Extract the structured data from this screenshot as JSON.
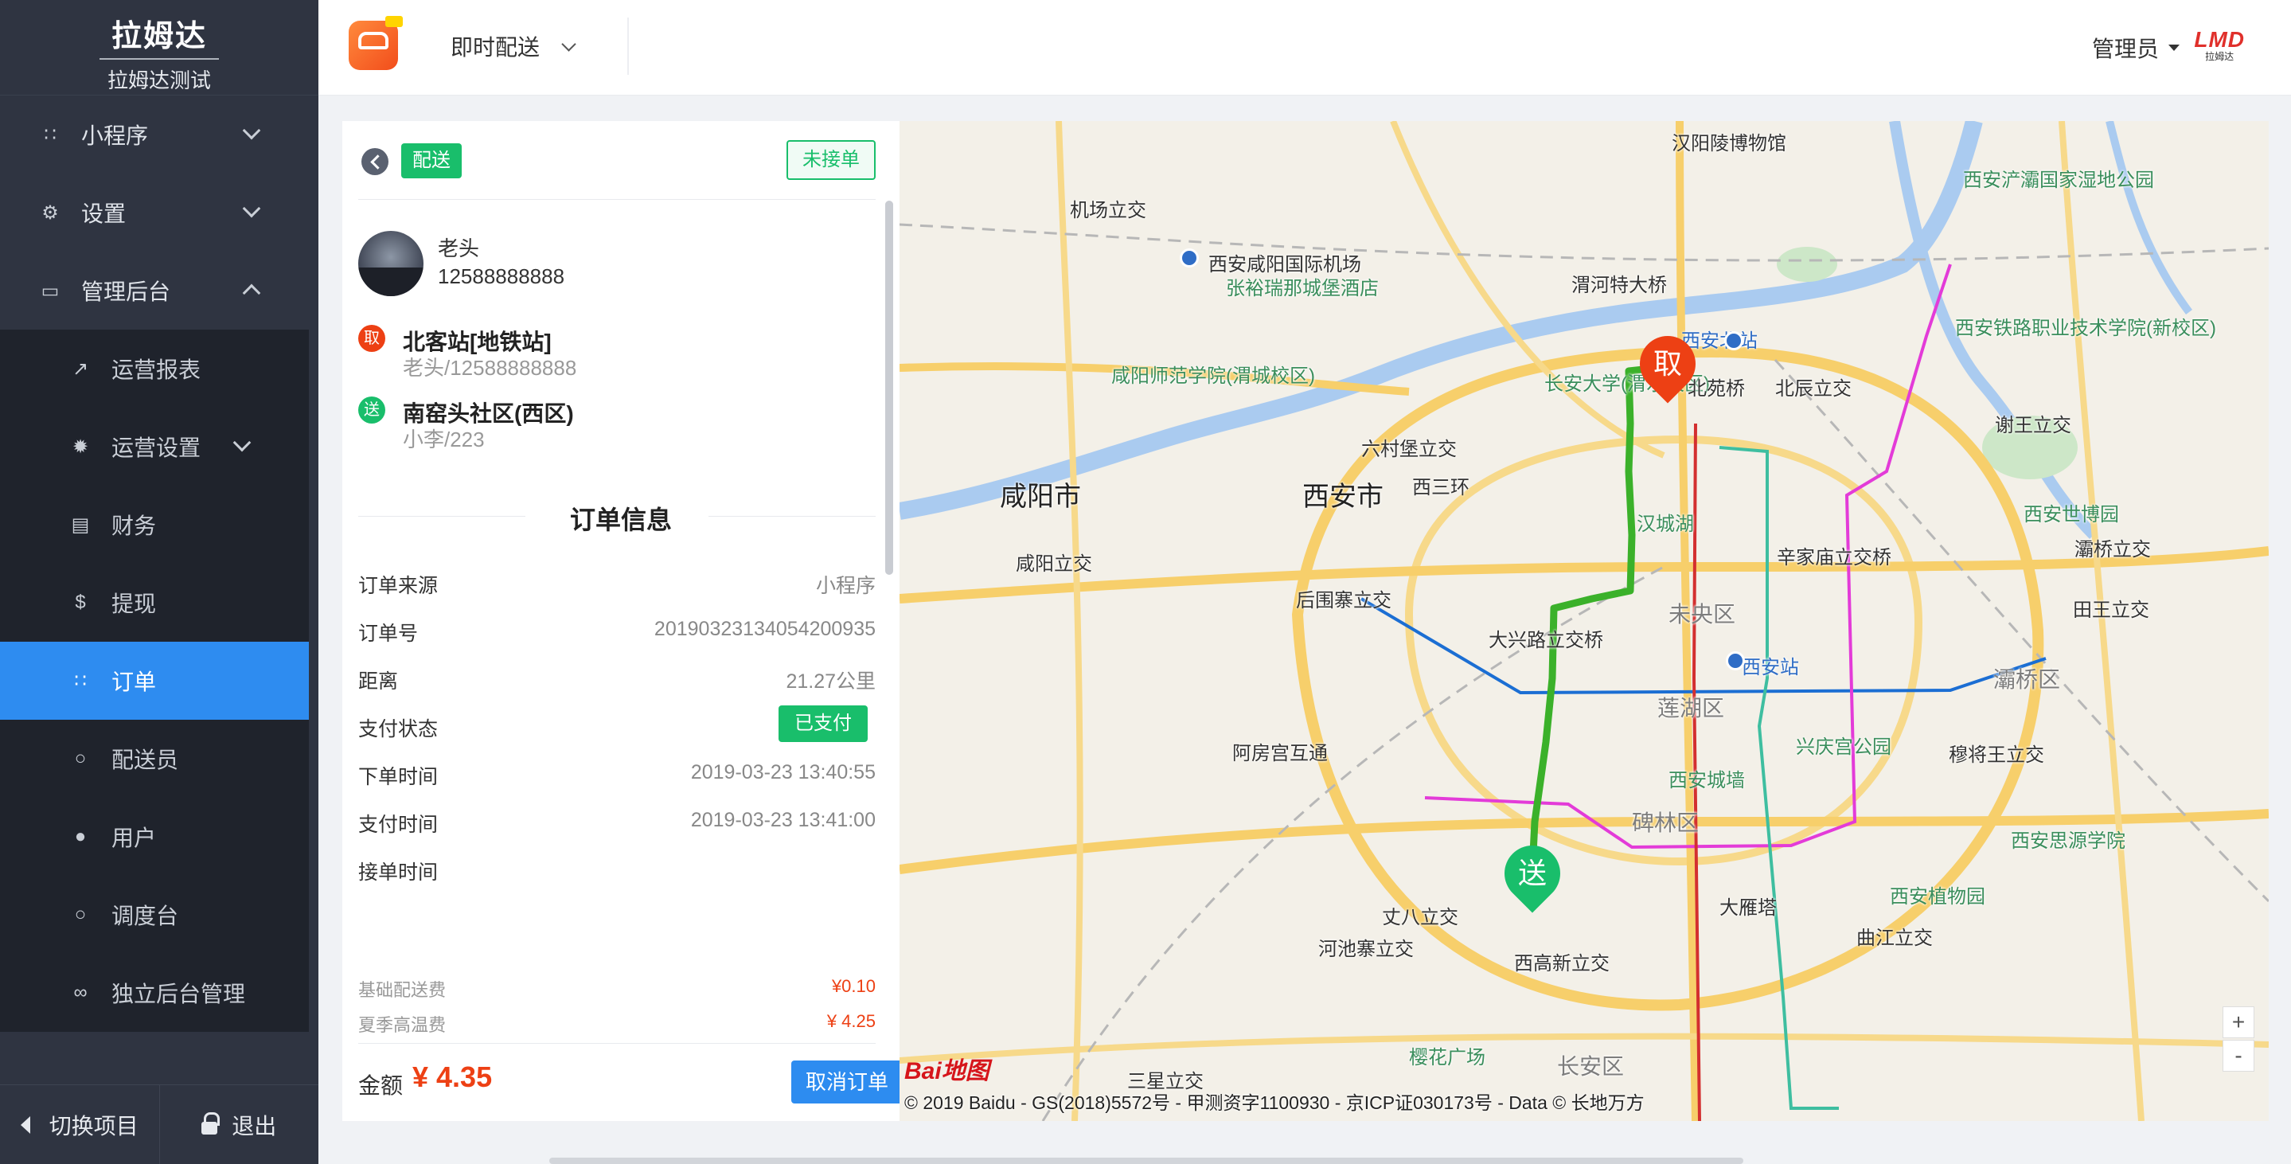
{
  "brand": {
    "title": "拉姆达",
    "subtitle": "拉姆达测试"
  },
  "sidebar": {
    "top_items": [
      {
        "label": "小程序",
        "icon": "grid-icon"
      },
      {
        "label": "设置",
        "icon": "gear-icon"
      },
      {
        "label": "管理后台",
        "icon": "monitor-icon"
      }
    ],
    "sub_items": [
      {
        "label": "运营报表",
        "icon": "trend-icon"
      },
      {
        "label": "运营设置",
        "icon": "cog-icon"
      },
      {
        "label": "财务",
        "icon": "wallet-icon"
      },
      {
        "label": "提现",
        "icon": "dollar-icon"
      },
      {
        "label": "订单",
        "icon": "grid-icon",
        "active": true
      },
      {
        "label": "配送员",
        "icon": "bike-icon"
      },
      {
        "label": "用户",
        "icon": "users-icon"
      },
      {
        "label": "调度台",
        "icon": "bike-icon"
      },
      {
        "label": "独立后台管理",
        "icon": "link-icon"
      }
    ],
    "footer": {
      "switch_label": "切换项目",
      "logout_label": "退出"
    }
  },
  "header": {
    "service_select": "即时配送",
    "admin_label": "管理员",
    "logo_text": "LMD",
    "logo_sub": "拉姆达"
  },
  "order": {
    "type_tag": "配送",
    "status_tag": "未接单",
    "user": {
      "name": "老头",
      "phone": "12588888888"
    },
    "pickup": {
      "badge": "取",
      "title": "北客站[地铁站]",
      "contact": "老头/12588888888"
    },
    "dropoff": {
      "badge": "送",
      "title": "南窑头社区(西区)",
      "contact": "小李/223"
    },
    "section_title": "订单信息",
    "rows": [
      {
        "label": "订单来源",
        "value": "小程序"
      },
      {
        "label": "订单号",
        "value": "20190323134054200935"
      },
      {
        "label": "距离",
        "value": "21.27公里"
      },
      {
        "label": "支付状态",
        "value": "已支付"
      },
      {
        "label": "下单时间",
        "value": "2019-03-23 13:40:55"
      },
      {
        "label": "支付时间",
        "value": "2019-03-23 13:41:00"
      },
      {
        "label": "接单时间",
        "value": ""
      }
    ],
    "fees": [
      {
        "label": "基础配送费",
        "value": "¥0.10"
      },
      {
        "label": "夏季高温费",
        "value": "¥ 4.25"
      }
    ],
    "total_label": "金额",
    "total_value": "¥ 4.35",
    "cancel_label": "取消订单"
  },
  "map": {
    "labels": {
      "xian": "西安市",
      "xianyang": "咸阳市",
      "weiyang": "未央区",
      "lianhu": "莲湖区",
      "beilin": "碑林区",
      "baqiao": "灞桥区",
      "changan": "长安区",
      "xian_north": "西安北站",
      "xian_station": "西安站",
      "airport": "西安咸阳国际机场",
      "hanyangling": "汉阳陵博物馆",
      "chanba": "西安浐灞国家湿地公园",
      "dayanta": "大雁塔",
      "xingqing": "兴庆宫公园",
      "botanical": "西安植物园",
      "expo": "西安世博园",
      "siyuan": "西安思源学院",
      "citywall": "西安城墙",
      "hancheng": "汉城湖",
      "chang_an_univ": "长安大学(渭水校区)",
      "railway_college": "西安铁路职业技术学院(新校区)",
      "normal": "咸阳师范学院(渭城校区)",
      "wei_bridge": "渭河特大桥",
      "beichen": "北辰立交",
      "beiyuan": "北苑桥",
      "liucunbao": "六村堡立交",
      "houweizhai": "后围寨立交",
      "daxing": "大兴路立交桥",
      "xinjiamiao": "辛家庙立交桥",
      "xiewang": "谢王立交",
      "baqiao_lj": "灞桥立交",
      "tianwang": "田王立交",
      "mujiang": "穆将王立交",
      "qujiang": "曲江立交",
      "xigao": "西高新立交",
      "hechizhai": "河池寨立交",
      "zhangba": "丈八立交",
      "epang": "阿房宫互通",
      "sanxing": "三星立交",
      "sakura": "樱花广场",
      "jichang_lj": "机场立交",
      "xianyang_lj": "咸阳立交",
      "zhangyurui": "张裕瑞那城堡酒店",
      "xisanhuan": "西三环"
    },
    "copyright": "© 2019 Baidu - GS(2018)5572号 - 甲测资字1100930 - 京ICP证030173号 - Data © 长地万方",
    "baidu_logo": "Bai地图",
    "pickup_marker": "取",
    "dropoff_marker": "送",
    "zoom_in": "+",
    "zoom_out": "-"
  }
}
